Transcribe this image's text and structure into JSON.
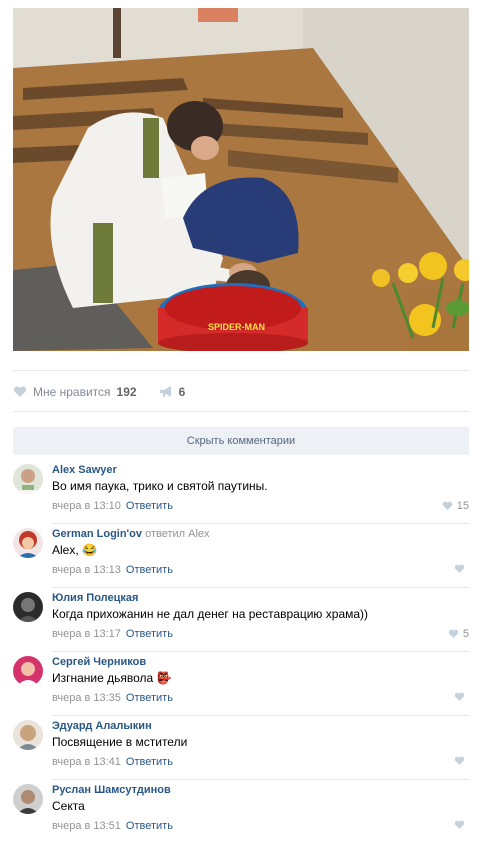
{
  "photo": {
    "pool_brand": "SPIDER-MAN"
  },
  "post_actions": {
    "like_label": "Мне нравится",
    "like_count": "192",
    "share_count": "6"
  },
  "hide_comments_label": "Скрыть комментарии",
  "comments": [
    {
      "author": "Alex Sawyer",
      "reply_word": "",
      "reply_to": "",
      "text": "Во имя паука, трико и святой паутины.",
      "time": "вчера в 13:10",
      "answer_label": "Ответить",
      "likes": "15",
      "avatar_color": "#8fb37d"
    },
    {
      "author": "German Login'ov",
      "reply_word": "ответил",
      "reply_to": "Alex",
      "text": "Alex, 😂",
      "time": "вчера в 13:13",
      "answer_label": "Ответить",
      "likes": "",
      "avatar_color": "#c0392b"
    },
    {
      "author": "Юлия Полецкая",
      "reply_word": "",
      "reply_to": "",
      "text": "Когда прихожанин не дал денег на реставрацию храма))",
      "time": "вчера в 13:17",
      "answer_label": "Ответить",
      "likes": "5",
      "avatar_color": "#2b2b2b"
    },
    {
      "author": "Сергей Черников",
      "reply_word": "",
      "reply_to": "",
      "text": "Изгнание дьявола 👺",
      "time": "вчера в 13:35",
      "answer_label": "Ответить",
      "likes": "",
      "avatar_color": "#d6336c"
    },
    {
      "author": "Эдуард Алалыкин",
      "reply_word": "",
      "reply_to": "",
      "text": "Посвящение в мстители",
      "time": "вчера в 13:41",
      "answer_label": "Ответить",
      "likes": "",
      "avatar_color": "#c9a27e"
    },
    {
      "author": "Руслан Шамсутдинов",
      "reply_word": "",
      "reply_to": "",
      "text": "Секта",
      "time": "вчера в 13:51",
      "answer_label": "Ответить",
      "likes": "",
      "avatar_color": "#3d3d3d"
    }
  ]
}
